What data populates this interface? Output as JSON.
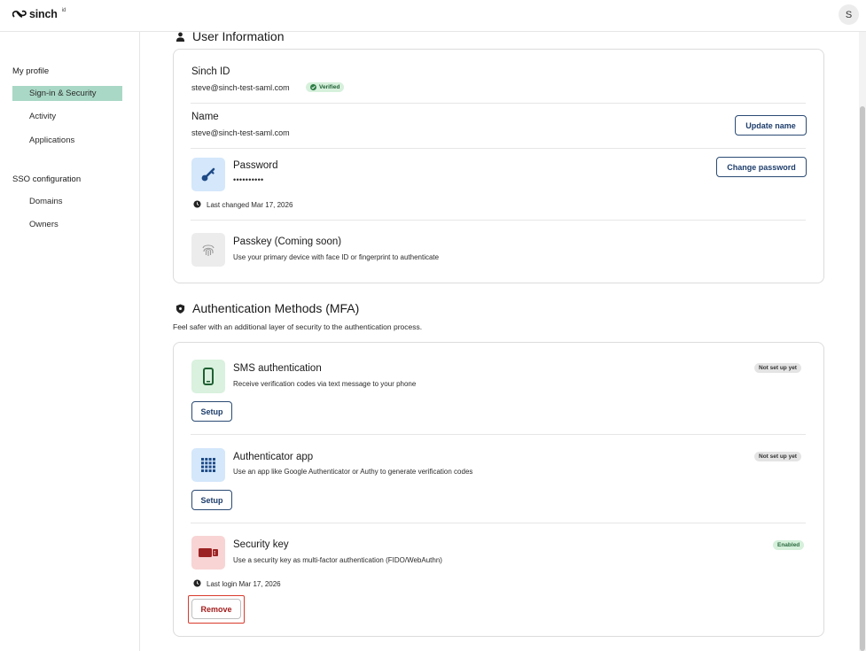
{
  "brand": {
    "logo_text": "sinch",
    "logo_suffix": "id"
  },
  "user": {
    "avatar_initial": "S"
  },
  "sidebar": {
    "sections": [
      {
        "label": "My profile",
        "items": [
          {
            "label": "Sign-in & Security"
          },
          {
            "label": "Activity"
          },
          {
            "label": "Applications"
          }
        ]
      },
      {
        "label": "SSO configuration",
        "items": [
          {
            "label": "Domains"
          },
          {
            "label": "Owners"
          }
        ]
      }
    ]
  },
  "user_info": {
    "title": "User Information",
    "sinch_id": {
      "label": "Sinch ID",
      "value": "steve@sinch-test-saml.com",
      "badge": "Verified"
    },
    "name": {
      "label": "Name",
      "value": "steve@sinch-test-saml.com",
      "button": "Update name"
    },
    "password": {
      "label": "Password",
      "value": "••••••••••",
      "button": "Change password",
      "last_changed": "Last changed Mar 17, 2026"
    },
    "passkey": {
      "label": "Passkey (Coming soon)",
      "description": "Use your primary device with face ID or fingerprint to authenticate"
    }
  },
  "mfa": {
    "title": "Authentication Methods (MFA)",
    "subtitle": "Feel safer with an additional layer of security to the authentication process.",
    "methods": [
      {
        "name": "SMS authentication",
        "description": "Receive verification codes via text message to your phone",
        "status": "Not set up yet",
        "action": "Setup"
      },
      {
        "name": "Authenticator app",
        "description": "Use an app like Google Authenticator or Authy to generate verification codes",
        "status": "Not set up yet",
        "action": "Setup"
      },
      {
        "name": "Security key",
        "description": "Use a security key as multi-factor authentication (FIDO/WebAuthn)",
        "status": "Enabled",
        "last_login": "Last login Mar 17, 2026",
        "action": "Remove"
      }
    ]
  },
  "colors": {
    "accent": "#a9d8c6",
    "button_border": "#2a4a73",
    "danger": "#a31d1d",
    "highlight": "#d93a2b"
  }
}
